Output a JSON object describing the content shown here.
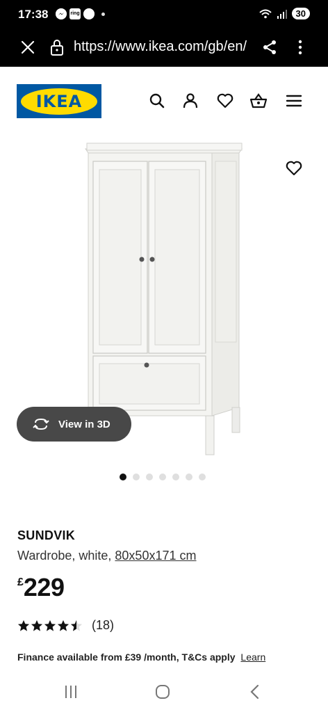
{
  "status_bar": {
    "time": "17:38",
    "notification_icons": [
      "messenger-icon",
      "ring-app-icon",
      "swirl-app-icon"
    ],
    "ring_label": "ring",
    "battery": "30"
  },
  "browser": {
    "url": "https://www.ikea.com/gb/en/"
  },
  "header": {
    "logo_text": "IKEA",
    "icons": [
      "search-icon",
      "user-icon",
      "heart-icon",
      "basket-icon",
      "menu-icon"
    ]
  },
  "gallery": {
    "view_3d_label": "View in 3D",
    "image_count": 7,
    "active_index": 0
  },
  "product": {
    "name": "SUNDVIK",
    "description": "Wardrobe, white,",
    "dimensions": "80x50x171 cm",
    "currency": "£",
    "price": "229",
    "rating_value": 4.5,
    "rating_max": 5,
    "review_count": "(18)",
    "finance_text": "Finance available from £39 /month, T&Cs apply",
    "finance_link": "Learn"
  },
  "colors": {
    "ikea_blue": "#0058a3",
    "ikea_yellow": "#ffdb00",
    "button_dark": "#484848"
  }
}
